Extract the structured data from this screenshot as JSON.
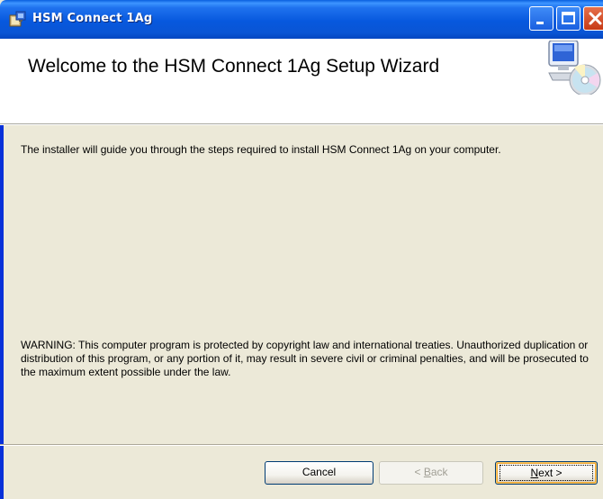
{
  "window": {
    "title": "HSM Connect 1Ag"
  },
  "header": {
    "title": "Welcome to the HSM Connect 1Ag Setup Wizard"
  },
  "body": {
    "intro": "The installer will guide you through the steps required to install HSM Connect 1Ag on your computer.",
    "warning": "WARNING: This computer program is protected by copyright law and international treaties. Unauthorized duplication or distribution of this program, or any portion of it, may result in severe civil or criminal penalties, and will be prosecuted to the maximum extent possible under the law."
  },
  "buttons": {
    "cancel": "Cancel",
    "back_prefix": "< ",
    "back_mnemonic": "B",
    "back_rest": "ack",
    "next_mnemonic": "N",
    "next_rest": "ext >"
  },
  "icons": {
    "app": "installer-icon",
    "header": "computer-cd-icon",
    "minimize": "minimize-icon",
    "maximize": "maximize-icon",
    "close": "close-icon"
  },
  "colors": {
    "titlebar": "#0a5fde",
    "dialog": "#ece9d8",
    "close_button": "#d8532a"
  }
}
